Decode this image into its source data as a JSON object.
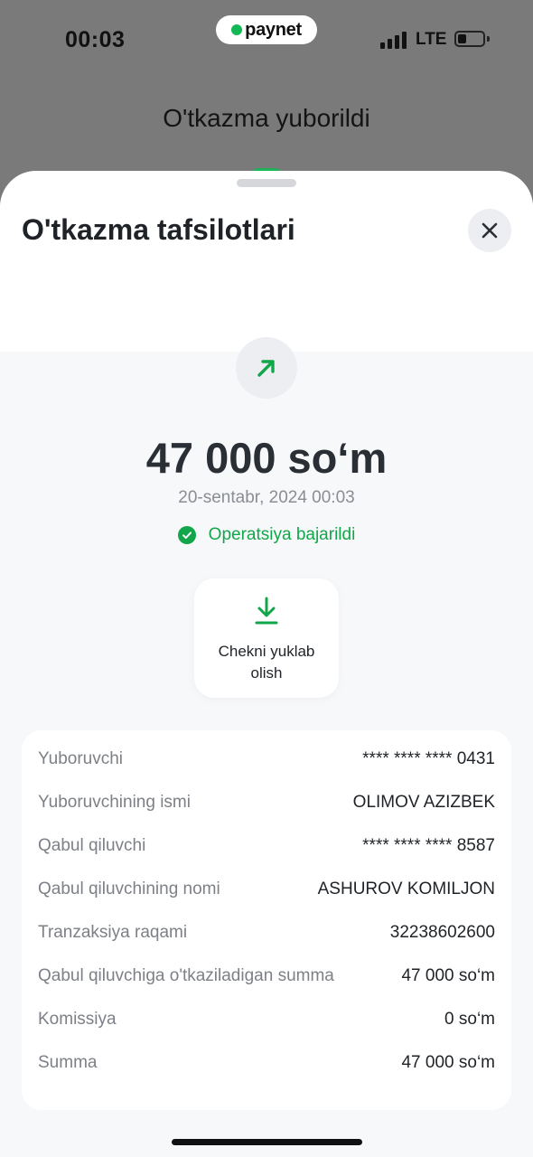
{
  "status_bar": {
    "time": "00:03",
    "brand": "paynet",
    "network": "LTE"
  },
  "background": {
    "title": "O'tkazma yuborildi"
  },
  "sheet": {
    "title": "O'tkazma tafsilotlari",
    "amount": "47 000 so‘m",
    "datetime": "20-sentabr, 2024 00:03",
    "status": "Operatsiya bajarildi",
    "receipt_button_line1": "Chekni yuklab",
    "receipt_button_line2": "olish"
  },
  "details": [
    {
      "label": "Yuboruvchi",
      "value": "**** **** **** 0431"
    },
    {
      "label": "Yuboruvchining ismi",
      "value": "OLIMOV AZIZBEK"
    },
    {
      "label": "Qabul qiluvchi",
      "value": "**** **** **** 8587"
    },
    {
      "label": "Qabul qiluvchining nomi",
      "value": "ASHUROV KOMILJON"
    },
    {
      "label": "Tranzaksiya raqami",
      "value": "32238602600"
    },
    {
      "label": "Qabul qiluvchiga o'tkaziladigan summa",
      "value": "47 000 so‘m"
    },
    {
      "label": "Komissiya",
      "value": "0 so‘m"
    },
    {
      "label": "Summa",
      "value": "47 000 so‘m"
    }
  ],
  "colors": {
    "accent_green": "#12a64a",
    "overlay": "#7a7a7a"
  },
  "icons": [
    "brand-dot-icon",
    "signal-icon",
    "battery-icon",
    "close-icon",
    "arrow-up-right-icon",
    "check-circle-icon",
    "download-icon"
  ]
}
